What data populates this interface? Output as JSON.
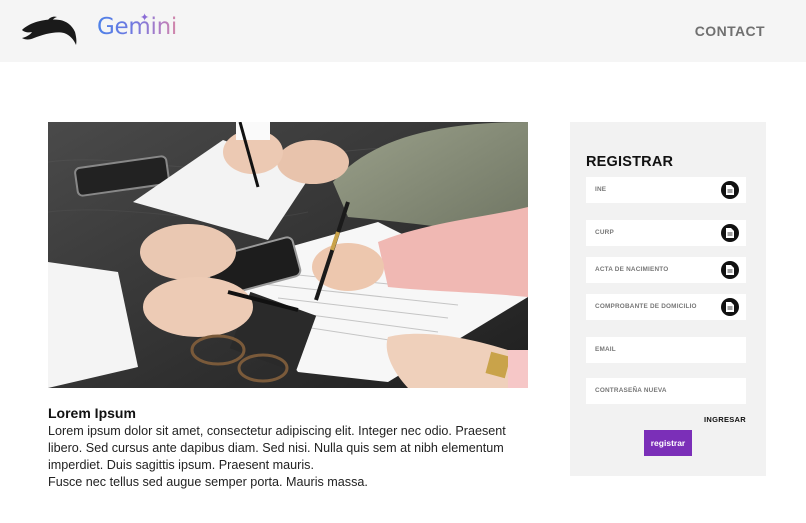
{
  "header": {
    "brand_wordmark": "Gemini",
    "nav_contact": "CONTACT"
  },
  "article": {
    "title": "Lorem Ipsum",
    "line1": "Lorem ipsum dolor sit amet, consectetur adipiscing elit. Integer nec odio. Praesent",
    "line2": "libero. Sed cursus ante dapibus diam. Sed nisi. Nulla quis sem at nibh elementum",
    "line3": "imperdiet. Duis sagittis ipsum. Praesent mauris.",
    "line4": "Fusce nec tellus sed augue semper porta. Mauris massa."
  },
  "form": {
    "title": "REGISTRAR",
    "fields": [
      {
        "label": "INE",
        "icon": "document-icon"
      },
      {
        "label": "CURP",
        "icon": "document-icon"
      },
      {
        "label": "ACTA DE NACIMIENTO",
        "icon": "document-icon"
      },
      {
        "label": "COMPROBANTE DE DOMICILIO",
        "icon": "document-icon"
      },
      {
        "label": "EMAIL"
      },
      {
        "label": "CONTRASEÑA NUEVA"
      }
    ],
    "login_link": "INGRESAR",
    "submit_label": "registrar"
  },
  "colors": {
    "header_bg": "#f5f5f5",
    "panel_bg": "#f2f2f2",
    "button_bg": "#7b2fb8"
  }
}
